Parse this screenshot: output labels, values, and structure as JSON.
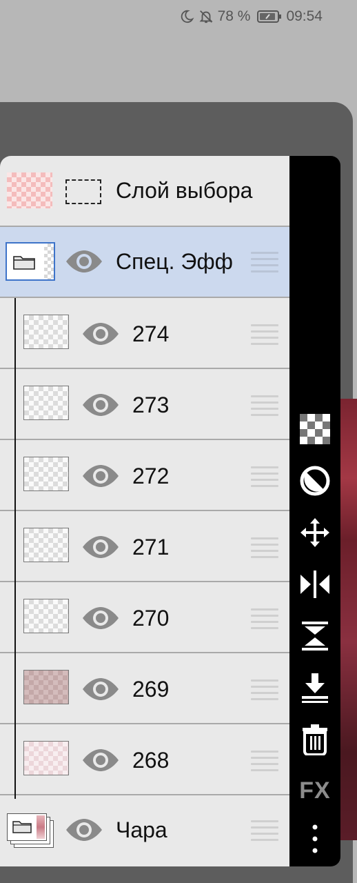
{
  "status_bar": {
    "battery_percent": "78 %",
    "time": "09:54",
    "icons": [
      "moon-icon",
      "bell-off-icon",
      "battery-icon"
    ]
  },
  "layers": [
    {
      "name": "Слой выбора",
      "type": "selection",
      "thumb": "pink-checker"
    },
    {
      "name": "Спец. Эфф",
      "type": "folder",
      "selected": true,
      "visible": true
    },
    {
      "name": "274",
      "type": "layer",
      "visible": true,
      "thumb": "checker"
    },
    {
      "name": "273",
      "type": "layer",
      "visible": true,
      "thumb": "checker"
    },
    {
      "name": "272",
      "type": "layer",
      "visible": true,
      "thumb": "checker"
    },
    {
      "name": "271",
      "type": "layer",
      "visible": true,
      "thumb": "checker"
    },
    {
      "name": "270",
      "type": "layer",
      "visible": true,
      "thumb": "checker"
    },
    {
      "name": "269",
      "type": "layer",
      "visible": true,
      "thumb": "brown-checker"
    },
    {
      "name": "268",
      "type": "layer",
      "visible": true,
      "thumb": "light-pink-checker"
    },
    {
      "name": "Чара",
      "type": "folder",
      "visible": true
    }
  ],
  "toolbar": {
    "tools": [
      "transparency-lock-icon",
      "clipping-icon",
      "move-icon",
      "flip-horizontal-icon",
      "flip-vertical-icon",
      "merge-down-icon",
      "trash-icon",
      "fx-icon",
      "more-vertical-icon"
    ],
    "fx_label": "FX"
  },
  "colors": {
    "selected_row": "#ccd9ee",
    "folder_border": "#3d73c9",
    "panel_bg": "#e9e9e9",
    "toolbar_bg": "#000000"
  }
}
